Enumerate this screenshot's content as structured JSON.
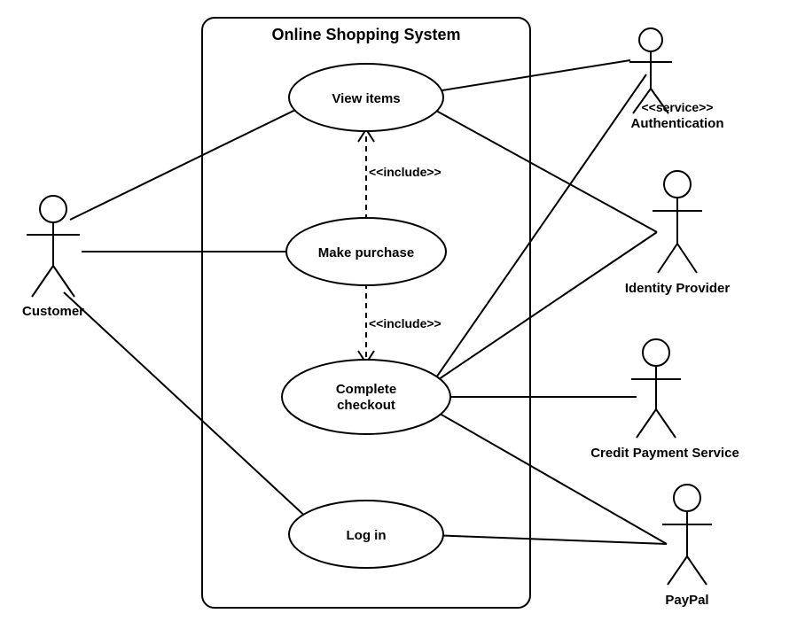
{
  "system": {
    "title": "Online Shopping System"
  },
  "usecases": {
    "view_items": "View items",
    "make_purchase": "Make purchase",
    "complete_checkout_l1": "Complete",
    "complete_checkout_l2": "checkout",
    "log_in": "Log in"
  },
  "actors": {
    "customer": "Customer",
    "auth_stereo": "<<service>>",
    "auth_name": "Authentication",
    "identity_provider": "Identity Provider",
    "credit_payment": "Credit Payment Service",
    "paypal": "PayPal"
  },
  "relations": {
    "include1": "<<include>>",
    "include2": "<<include>>"
  }
}
